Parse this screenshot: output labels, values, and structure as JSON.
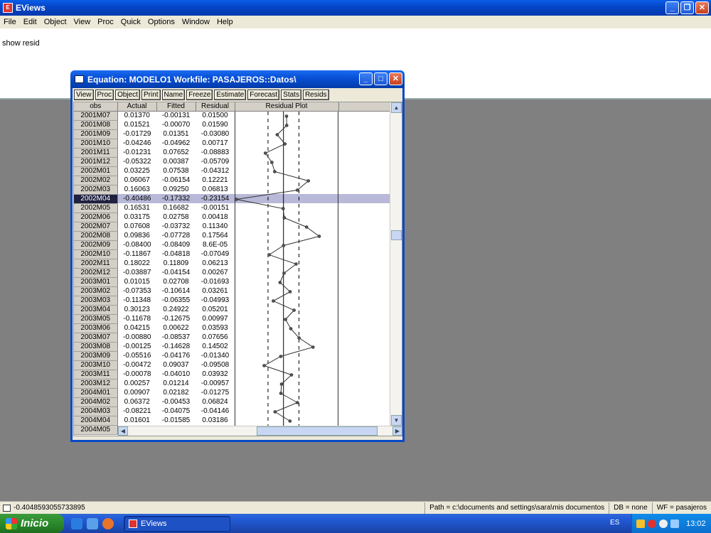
{
  "app": {
    "title": "EViews",
    "menu": [
      "File",
      "Edit",
      "Object",
      "View",
      "Proc",
      "Quick",
      "Options",
      "Window",
      "Help"
    ],
    "command": "show resid"
  },
  "equation_window": {
    "title": "Equation: MODELO1   Workfile: PASAJEROS::Datos\\",
    "toolbar": [
      "View",
      "Proc",
      "Object",
      "Print",
      "Name",
      "Freeze",
      "Estimate",
      "Forecast",
      "Stats",
      "Resids"
    ],
    "columns": [
      "obs",
      "Actual",
      "Fitted",
      "Residual",
      "Residual Plot"
    ],
    "selected_row": "2002M04",
    "rows": [
      {
        "obs": "2001M07",
        "actual": "0.01370",
        "fitted": "-0.00131",
        "residual": "0.01500"
      },
      {
        "obs": "2001M08",
        "actual": "0.01521",
        "fitted": "-0.00070",
        "residual": "0.01590"
      },
      {
        "obs": "2001M09",
        "actual": "-0.01729",
        "fitted": "0.01351",
        "residual": "-0.03080"
      },
      {
        "obs": "2001M10",
        "actual": "-0.04246",
        "fitted": "-0.04962",
        "residual": "0.00717"
      },
      {
        "obs": "2001M11",
        "actual": "-0.01231",
        "fitted": "0.07652",
        "residual": "-0.08883"
      },
      {
        "obs": "2001M12",
        "actual": "-0.05322",
        "fitted": "0.00387",
        "residual": "-0.05709"
      },
      {
        "obs": "2002M01",
        "actual": "0.03225",
        "fitted": "0.07538",
        "residual": "-0.04312"
      },
      {
        "obs": "2002M02",
        "actual": "0.06067",
        "fitted": "-0.06154",
        "residual": "0.12221"
      },
      {
        "obs": "2002M03",
        "actual": "0.16063",
        "fitted": "0.09250",
        "residual": "0.06813"
      },
      {
        "obs": "2002M04",
        "actual": "-0.40486",
        "fitted": "-0.17332",
        "residual": "-0.23154"
      },
      {
        "obs": "2002M05",
        "actual": "0.16531",
        "fitted": "0.16682",
        "residual": "-0.00151"
      },
      {
        "obs": "2002M06",
        "actual": "0.03175",
        "fitted": "0.02758",
        "residual": "0.00418"
      },
      {
        "obs": "2002M07",
        "actual": "0.07608",
        "fitted": "-0.03732",
        "residual": "0.11340"
      },
      {
        "obs": "2002M08",
        "actual": "0.09836",
        "fitted": "-0.07728",
        "residual": "0.17564"
      },
      {
        "obs": "2002M09",
        "actual": "-0.08400",
        "fitted": "-0.08409",
        "residual": "8.6E-05"
      },
      {
        "obs": "2002M10",
        "actual": "-0.11867",
        "fitted": "-0.04818",
        "residual": "-0.07049"
      },
      {
        "obs": "2002M11",
        "actual": "0.18022",
        "fitted": "0.11809",
        "residual": "0.06213"
      },
      {
        "obs": "2002M12",
        "actual": "-0.03887",
        "fitted": "-0.04154",
        "residual": "0.00267"
      },
      {
        "obs": "2003M01",
        "actual": "0.01015",
        "fitted": "0.02708",
        "residual": "-0.01693"
      },
      {
        "obs": "2003M02",
        "actual": "-0.07353",
        "fitted": "-0.10614",
        "residual": "0.03261"
      },
      {
        "obs": "2003M03",
        "actual": "-0.11348",
        "fitted": "-0.06355",
        "residual": "-0.04993"
      },
      {
        "obs": "2003M04",
        "actual": "0.30123",
        "fitted": "0.24922",
        "residual": "0.05201"
      },
      {
        "obs": "2003M05",
        "actual": "-0.11678",
        "fitted": "-0.12675",
        "residual": "0.00997"
      },
      {
        "obs": "2003M06",
        "actual": "0.04215",
        "fitted": "0.00622",
        "residual": "0.03593"
      },
      {
        "obs": "2003M07",
        "actual": "-0.00880",
        "fitted": "-0.08537",
        "residual": "0.07656"
      },
      {
        "obs": "2003M08",
        "actual": "-0.00125",
        "fitted": "-0.14628",
        "residual": "0.14502"
      },
      {
        "obs": "2003M09",
        "actual": "-0.05516",
        "fitted": "-0.04176",
        "residual": "-0.01340"
      },
      {
        "obs": "2003M10",
        "actual": "-0.00472",
        "fitted": "0.09037",
        "residual": "-0.09508"
      },
      {
        "obs": "2003M11",
        "actual": "-0.00078",
        "fitted": "-0.04010",
        "residual": "0.03932"
      },
      {
        "obs": "2003M12",
        "actual": "0.00257",
        "fitted": "0.01214",
        "residual": "-0.00957"
      },
      {
        "obs": "2004M01",
        "actual": "0.00907",
        "fitted": "0.02182",
        "residual": "-0.01275"
      },
      {
        "obs": "2004M02",
        "actual": "0.06372",
        "fitted": "-0.00453",
        "residual": "0.06824"
      },
      {
        "obs": "2004M03",
        "actual": "-0.08221",
        "fitted": "-0.04075",
        "residual": "-0.04146"
      },
      {
        "obs": "2004M04",
        "actual": "0.01601",
        "fitted": "-0.01585",
        "residual": "0.03186"
      },
      {
        "obs": "2004M05",
        "actual": "",
        "fitted": "",
        "residual": ""
      }
    ]
  },
  "chart_data": {
    "type": "line",
    "title": "Residual Plot",
    "x": [
      "2001M07",
      "2001M08",
      "2001M09",
      "2001M10",
      "2001M11",
      "2001M12",
      "2002M01",
      "2002M02",
      "2002M03",
      "2002M04",
      "2002M05",
      "2002M06",
      "2002M07",
      "2002M08",
      "2002M09",
      "2002M10",
      "2002M11",
      "2002M12",
      "2003M01",
      "2003M02",
      "2003M03",
      "2003M04",
      "2003M05",
      "2003M06",
      "2003M07",
      "2003M08",
      "2003M09",
      "2003M10",
      "2003M11",
      "2003M12",
      "2004M01",
      "2004M02",
      "2004M03",
      "2004M04"
    ],
    "series": [
      {
        "values": [
          0.015,
          0.0159,
          -0.0308,
          0.00717,
          -0.08883,
          -0.05709,
          -0.04312,
          0.12221,
          0.06813,
          -0.23154,
          -0.00151,
          0.00418,
          0.1134,
          0.17564,
          8.6e-05,
          -0.07049,
          0.06213,
          0.00267,
          -0.01693,
          0.03261,
          -0.04993,
          0.05201,
          0.00997,
          0.03593,
          0.07656,
          0.14502,
          -0.0134,
          -0.09508,
          0.03932,
          -0.00957,
          -0.01275,
          0.06824,
          -0.04146,
          0.03186
        ]
      }
    ],
    "reference_lines": [
      0
    ],
    "xlim": [
      -0.24,
      0.27
    ]
  },
  "statusbar": {
    "value": "-0.4048593055733895",
    "path": "Path = c:\\documents and settings\\sara\\mis documentos",
    "db": "DB = none",
    "wf": "WF = pasajeros"
  },
  "taskbar": {
    "start_label": "Inicio",
    "task_label": "EViews",
    "lang": "ES",
    "clock": "13:02"
  },
  "colors": {
    "titlebar": "#0446c8",
    "selection": "#b8b8d8",
    "start": "#2b8a2b"
  }
}
